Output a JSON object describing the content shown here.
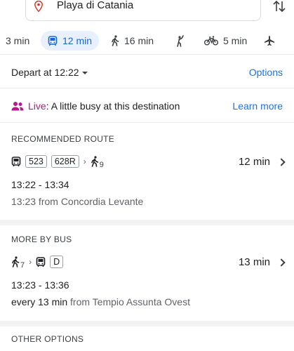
{
  "destination": {
    "value": "Playa di Catania"
  },
  "modes": [
    {
      "label": "3 min",
      "icon": "car-icon"
    },
    {
      "label": "12 min",
      "icon": "transit-icon",
      "active": true
    },
    {
      "label": "16 min",
      "icon": "walk-icon"
    },
    {
      "label": "",
      "icon": "ride-hail-icon"
    },
    {
      "label": "5 min",
      "icon": "bike-icon"
    },
    {
      "label": "",
      "icon": "flight-icon"
    }
  ],
  "depart": {
    "label": "Depart at 12:22",
    "options": "Options"
  },
  "live": {
    "label": "Live",
    "text": ": A little busy at this destination",
    "action": "Learn more"
  },
  "recommended": {
    "heading": "RECOMMENDED ROUTE",
    "lines": [
      "523",
      "628R"
    ],
    "walk_minutes": "9",
    "duration": "12 min",
    "times": "13:22 - 13:34",
    "from": "13:23 from Concordia Levante"
  },
  "more_by_bus": {
    "heading": "MORE BY BUS",
    "walk_minutes": "7",
    "lines": [
      "D"
    ],
    "duration": "13 min",
    "times": "13:23 - 13:36",
    "frequency": "every 13 min",
    "from": " from Tempio Assunta Ovest"
  },
  "other": {
    "heading": "OTHER OPTIONS"
  },
  "colors": {
    "accent": "#1a73e8",
    "active_bg": "#e8f0fe",
    "live": "#b31a8c",
    "pin": "#d93025"
  }
}
